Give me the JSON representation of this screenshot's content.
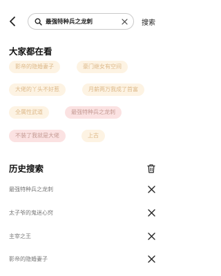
{
  "header": {
    "search_query": "最强特种兵之龙刺",
    "search_button": "搜索",
    "back_icon": "chevron-left-icon",
    "search_icon": "search-icon",
    "clear_icon": "close-circle-icon"
  },
  "trending": {
    "title": "大家都在看",
    "items": [
      {
        "label": "影帝的隐婚妻子",
        "style": "light"
      },
      {
        "label": "豪门继女有空间",
        "style": "light"
      },
      {
        "label": "大佬的丫头不好惹",
        "style": "light"
      },
      {
        "label": "月薪两万我成了首富",
        "style": "light"
      },
      {
        "label": "全属性武道",
        "style": "light"
      },
      {
        "label": "最强特种兵之龙刺",
        "style": "pink"
      },
      {
        "label": "不装了我就是大佬",
        "style": "pink"
      },
      {
        "label": "上古",
        "style": "light"
      }
    ]
  },
  "history": {
    "title": "历史搜索",
    "clear_all_icon": "trash-icon",
    "items": [
      {
        "label": "最强特种兵之龙刺"
      },
      {
        "label": "太子爷的鬼迷心窍"
      },
      {
        "label": "主宰之王"
      },
      {
        "label": "影帝的隐婚妻子"
      }
    ]
  },
  "colors": {
    "chip_light_bg": "#fdf3e3",
    "chip_light_text": "#ddb98a",
    "chip_pink_bg": "#fbe2e2",
    "chip_pink_text": "#c49a93"
  }
}
